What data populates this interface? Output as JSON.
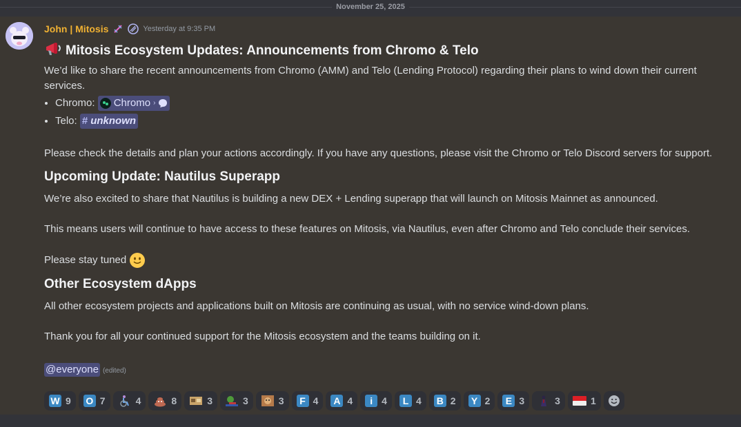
{
  "date_divider": "November 25, 2025",
  "author": {
    "name": "John | Mitosis",
    "timestamp": "Yesterday at 9:35 PM",
    "name_color": "#f0b132"
  },
  "post": {
    "title_emoji": "loudspeaker-icon",
    "title": "Mitosis Ecosystem Updates: Announcements from Chromo & Telo",
    "intro": "We’d like to share the recent announcements from Chromo (AMM) and Telo (Lending Protocol) regarding their plans to wind down their current services.",
    "list": [
      {
        "label": "Chromo:",
        "link": "Chromo"
      },
      {
        "label": "Telo:",
        "link": "unknown"
      }
    ],
    "check_details": "Please check the details and plan your actions accordingly. If you have any questions, please visit the Chromo or Telo Discord servers for support.",
    "section2_title": "Upcoming Update: Nautilus Superapp",
    "section2_p1": "We’re also excited to share that Nautilus is building a new DEX + Lending superapp that will launch on Mitosis Mainnet as announced.",
    "section2_p2": "This means users will continue to have access to these features on Mitosis, via Nautilus, even after Chromo and Telo conclude their services.",
    "section2_p3": "Please stay tuned",
    "section3_title": "Other Ecosystem dApps",
    "section3_p1": "All other ecosystem projects and applications built on Mitosis are continuing as usual, with no service wind-down plans.",
    "section3_p2": "Thank you for all your continued support for the Mitosis ecosystem and the teams building on it.",
    "mention": "@everyone",
    "edited": "(edited)"
  },
  "reactions": [
    {
      "emoji": "W",
      "type": "letter",
      "count": "9"
    },
    {
      "emoji": "O",
      "type": "letter",
      "count": "7"
    },
    {
      "emoji": "wheelchair-icon",
      "type": "icon",
      "count": "4"
    },
    {
      "emoji": "poop-icon",
      "type": "icon",
      "count": "8"
    },
    {
      "emoji": "custom-emoji-1",
      "type": "icon",
      "count": "3"
    },
    {
      "emoji": "custom-emoji-2",
      "type": "icon",
      "count": "3"
    },
    {
      "emoji": "custom-emoji-3",
      "type": "icon",
      "count": "3"
    },
    {
      "emoji": "F",
      "type": "letter",
      "count": "4"
    },
    {
      "emoji": "A",
      "type": "letter",
      "count": "4"
    },
    {
      "emoji": "i",
      "type": "letter",
      "count": "4"
    },
    {
      "emoji": "L",
      "type": "letter",
      "count": "4"
    },
    {
      "emoji": "B",
      "type": "letter",
      "count": "2"
    },
    {
      "emoji": "Y",
      "type": "letter",
      "count": "2"
    },
    {
      "emoji": "E",
      "type": "letter",
      "count": "3"
    },
    {
      "emoji": "custom-emoji-4",
      "type": "icon",
      "count": "3"
    },
    {
      "emoji": "indonesia-flag-icon",
      "type": "icon",
      "count": "1"
    }
  ]
}
